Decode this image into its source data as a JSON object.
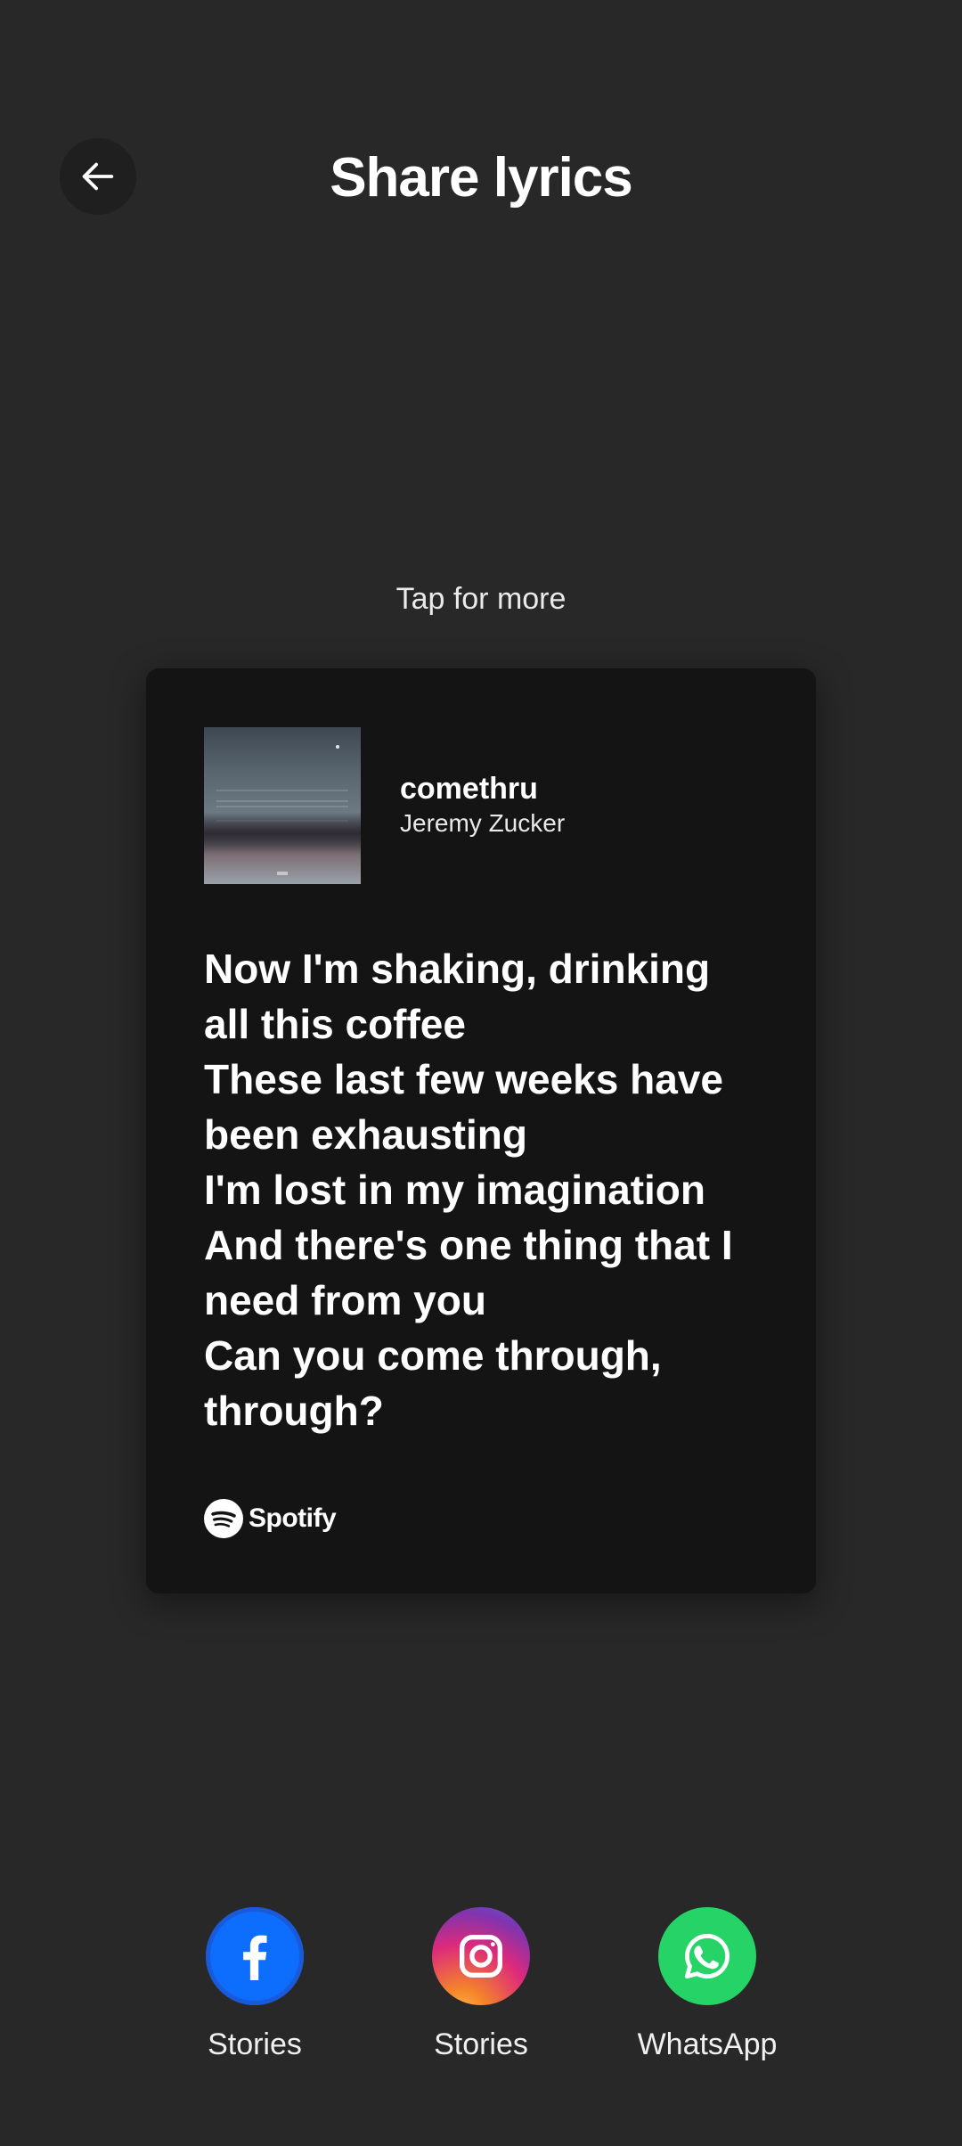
{
  "header": {
    "title": "Share lyrics",
    "back_icon": "arrow-left-icon"
  },
  "hint": "Tap for more",
  "card": {
    "song_title": "comethru",
    "artist": "Jeremy Zucker",
    "lyrics": [
      "Now I'm shaking, drinking",
      "all this coffee",
      "These last few weeks have",
      "been exhausting",
      "I'm lost in my imagination",
      "And there's one thing that I",
      "need from you",
      "Can you come through,",
      "through?"
    ],
    "brand": "Spotify"
  },
  "share_targets": [
    {
      "label": "Stories",
      "icon": "facebook-icon",
      "color": "#1877f2"
    },
    {
      "label": "Stories",
      "icon": "instagram-icon",
      "color": "#dd2a7b"
    },
    {
      "label": "WhatsApp",
      "icon": "whatsapp-icon",
      "color": "#25d366"
    }
  ],
  "colors": {
    "background": "#282828",
    "card": "#141414",
    "text": "#ffffff"
  }
}
